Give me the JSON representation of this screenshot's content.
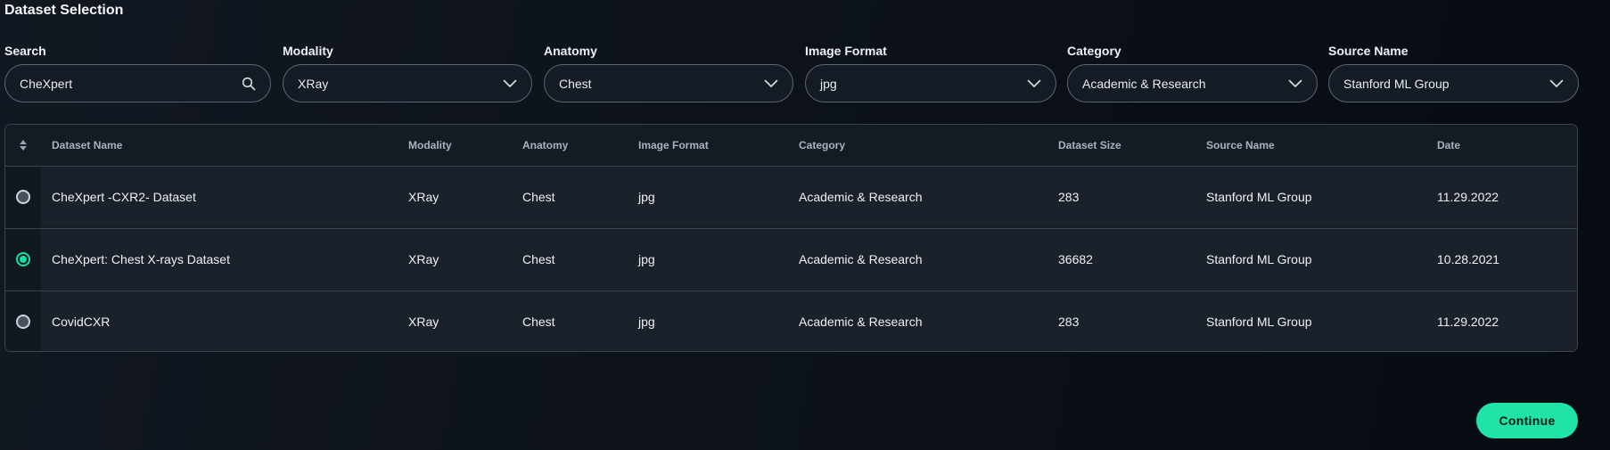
{
  "title": "Dataset Selection",
  "filters": {
    "search": {
      "label": "Search",
      "value": "CheXpert",
      "placeholder": ""
    },
    "modality": {
      "label": "Modality",
      "value": "XRay"
    },
    "anatomy": {
      "label": "Anatomy",
      "value": "Chest"
    },
    "image_format": {
      "label": "Image Format",
      "value": "jpg"
    },
    "category": {
      "label": "Category",
      "value": "Academic & Research"
    },
    "source_name": {
      "label": "Source Name",
      "value": "Stanford ML Group"
    }
  },
  "table": {
    "columns": [
      "Dataset Name",
      "Modality",
      "Anatomy",
      "Image Format",
      "Category",
      "Dataset Size",
      "Source Name",
      "Date"
    ],
    "rows": [
      {
        "selected": false,
        "cells": [
          "CheXpert -CXR2- Dataset",
          "XRay",
          "Chest",
          "jpg",
          "Academic & Research",
          "283",
          "Stanford ML Group",
          "11.29.2022"
        ]
      },
      {
        "selected": true,
        "cells": [
          "CheXpert: Chest X-rays Dataset",
          "XRay",
          "Chest",
          "jpg",
          "Academic & Research",
          "36682",
          "Stanford ML Group",
          "10.28.2021"
        ]
      },
      {
        "selected": false,
        "cells": [
          "CovidCXR",
          "XRay",
          "Chest",
          "jpg",
          "Academic & Research",
          "283",
          "Stanford ML Group",
          "11.29.2022"
        ]
      }
    ]
  },
  "continue_label": "Continue",
  "colors": {
    "accent": "#20e3a8",
    "radio_selected": "#17e0a6"
  },
  "icons": {
    "search": "search-icon",
    "dropdown": "chevron-down-icon",
    "sort": "sort-icon"
  }
}
